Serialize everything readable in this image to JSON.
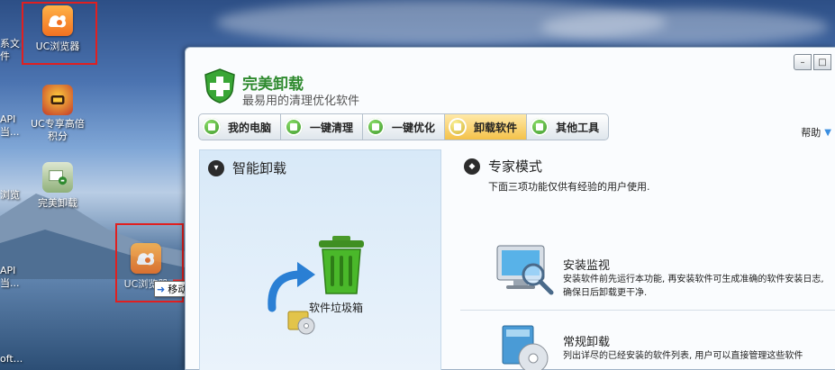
{
  "desktop": {
    "icons": [
      {
        "label": "UC浏览器"
      },
      {
        "label": "UC专享高倍积分"
      },
      {
        "label": "完美卸载"
      },
      {
        "label": "UC浏览器"
      }
    ],
    "edge_fragments": [
      "系文",
      "件",
      "API",
      "当...",
      "浏览",
      "API",
      "当...",
      "oft..."
    ],
    "drag_tooltip": {
      "icon": "move-arrow-icon",
      "text": "移动到 桌面"
    }
  },
  "window": {
    "controls": {
      "minimize": "–",
      "maximize": "□"
    },
    "app_title": "完美卸载",
    "app_subtitle": "最易用的清理优化软件",
    "tabs": [
      {
        "label": "我的电脑",
        "active": false
      },
      {
        "label": "一键清理",
        "active": false
      },
      {
        "label": "一键优化",
        "active": false
      },
      {
        "label": "卸载软件",
        "active": true
      },
      {
        "label": "其他工具",
        "active": false
      }
    ],
    "help_label": "帮助",
    "smart_uninstall": {
      "title": "智能卸载",
      "trash_label": "软件垃圾箱"
    },
    "expert": {
      "title": "专家模式",
      "description": "下面三项功能仅供有经验的用户使用.",
      "features": [
        {
          "title": "安装监视",
          "description": "安装软件前先运行本功能, 再安装软件可生成准确的软件安装日志, 确保日后卸载更干净."
        },
        {
          "title": "常规卸载",
          "description": "列出详尽的已经安装的软件列表, 用户可以直接管理这些软件"
        }
      ]
    }
  },
  "colors": {
    "brand_green": "#2f8a2f",
    "highlight_red": "#e02020",
    "active_tab": "#f4c24a"
  }
}
